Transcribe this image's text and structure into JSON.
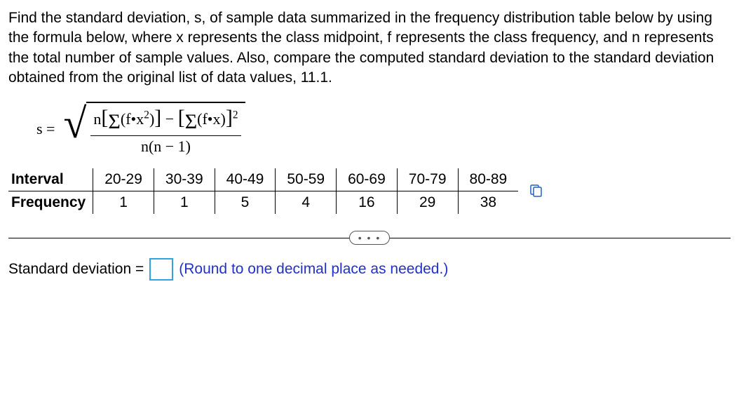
{
  "prompt": "Find the standard deviation, s, of sample data summarized in the frequency distribution table below by using the formula below, where x represents the class midpoint, f represents the class frequency, and n represents the total number of sample values. Also, compare the computed standard deviation to the standard deviation obtained from the original list of data values, 11.1.",
  "formula": {
    "lhs": "s =",
    "numerator_tex": "n[Σ(f·x²)] − [Σ(f·x)]²",
    "denominator_tex": "n(n − 1)"
  },
  "table": {
    "row1_label": "Interval",
    "row2_label": "Frequency",
    "intervals": [
      "20-29",
      "30-39",
      "40-49",
      "50-59",
      "60-69",
      "70-79",
      "80-89"
    ],
    "frequencies": [
      "1",
      "1",
      "5",
      "4",
      "16",
      "29",
      "38"
    ]
  },
  "divider": {
    "ellipsis": "• • •"
  },
  "answer": {
    "label": "Standard deviation =",
    "hint": "(Round to one decimal place as needed.)",
    "value": ""
  }
}
